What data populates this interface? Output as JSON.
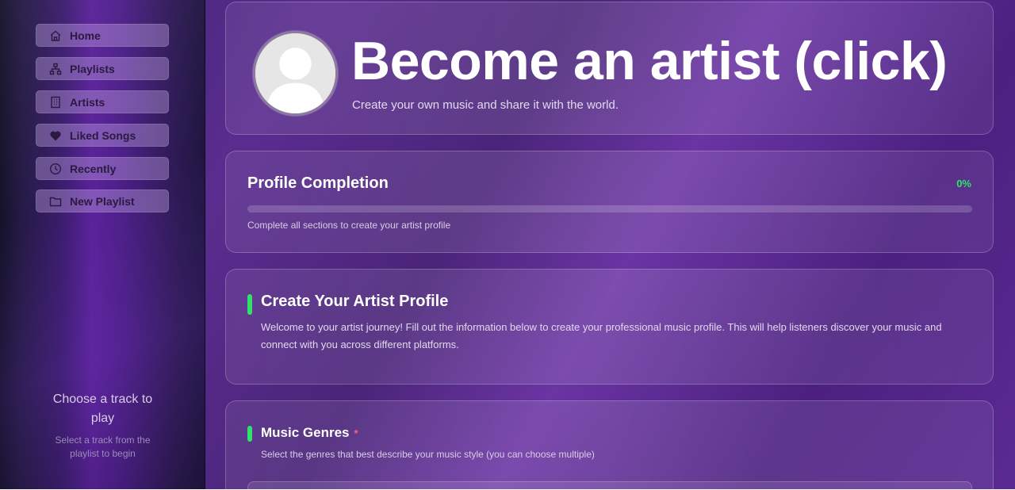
{
  "sidebar": {
    "items": [
      {
        "label": "Home",
        "icon": "home-icon"
      },
      {
        "label": "Playlists",
        "icon": "sitemap-icon"
      },
      {
        "label": "Artists",
        "icon": "building-icon"
      },
      {
        "label": "Liked Songs",
        "icon": "heart-icon"
      },
      {
        "label": "Recently",
        "icon": "clock-icon"
      },
      {
        "label": "New Playlist",
        "icon": "folder-icon"
      }
    ],
    "now_playing": {
      "title": "Choose a track to play",
      "subtitle": "Select a track from the playlist to begin"
    }
  },
  "hero": {
    "title": "Become an artist (click)",
    "subtitle": "Create your own music and share it with the world."
  },
  "profile_completion": {
    "title": "Profile Completion",
    "percent_label": "0%",
    "progress": 0,
    "hint": "Complete all sections to create your artist profile"
  },
  "intro": {
    "title": "Create Your Artist Profile",
    "text": "Welcome to your artist journey! Fill out the information below to create your professional music profile. This will help listeners discover your music and connect with you across different platforms."
  },
  "genres": {
    "title": "Music Genres",
    "required_mark": "*",
    "hint": "Select the genres that best describe your music style (you can choose multiple)"
  },
  "colors": {
    "accent": "#2ee36b",
    "required": "#ff5f6d",
    "background": "#4a2479"
  }
}
